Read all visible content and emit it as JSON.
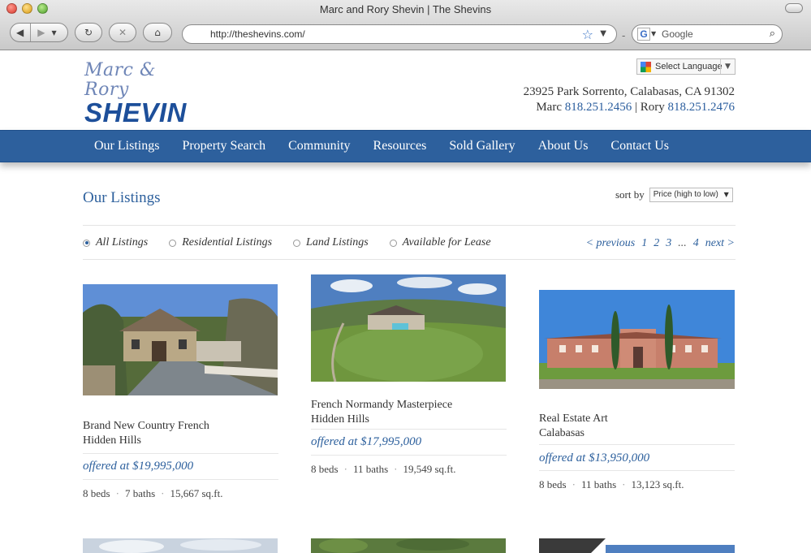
{
  "browser": {
    "window_title": "Marc and Rory Shevin | The Shevins",
    "url": "http://theshevins.com/",
    "search_placeholder": "Google",
    "search_engine_letter": "G"
  },
  "header": {
    "logo_script": "Marc & Rory",
    "logo_main": "SHEVIN",
    "language_select": "Select Language",
    "address": "23925 Park Sorrento, Calabasas, CA 91302",
    "marc_label": "Marc",
    "marc_phone": "818.251.2456",
    "separator": "|",
    "rory_label": "Rory",
    "rory_phone": "818.251.2476"
  },
  "nav": {
    "items": [
      {
        "label": "Our Listings"
      },
      {
        "label": "Property Search"
      },
      {
        "label": "Community"
      },
      {
        "label": "Resources"
      },
      {
        "label": "Sold Gallery"
      },
      {
        "label": "About Us"
      },
      {
        "label": "Contact Us"
      }
    ]
  },
  "listings_page": {
    "title": "Our Listings",
    "sort_label": "sort by",
    "sort_value": "Price (high to low)",
    "filters": [
      {
        "label": "All Listings",
        "selected": true
      },
      {
        "label": "Residential Listings",
        "selected": false
      },
      {
        "label": "Land Listings",
        "selected": false
      },
      {
        "label": "Available for Lease",
        "selected": false
      }
    ],
    "pager": {
      "previous": "< previous",
      "pages": [
        "1",
        "2",
        "3"
      ],
      "ellipsis": "...",
      "last_page": "4",
      "next": "next >"
    }
  },
  "listings": [
    {
      "name_line1": "Brand New Country French",
      "name_line2": "Hidden Hills",
      "price": "offered at $19,995,000",
      "beds": "8 beds",
      "baths": "7 baths",
      "sqft": "15,667 sq.ft."
    },
    {
      "name_line1": "French Normandy Masterpiece",
      "name_line2": "Hidden Hills",
      "price": "offered at $17,995,000",
      "beds": "8 beds",
      "baths": "11 baths",
      "sqft": "19,549 sq.ft."
    },
    {
      "name_line1": "Real Estate Art",
      "name_line2": "Calabasas",
      "price": "offered at $13,950,000",
      "beds": "8 beds",
      "baths": "11 baths",
      "sqft": "13,123 sq.ft."
    }
  ],
  "colors": {
    "brand_blue": "#2d609d",
    "logo_blue": "#1d4f9a"
  }
}
